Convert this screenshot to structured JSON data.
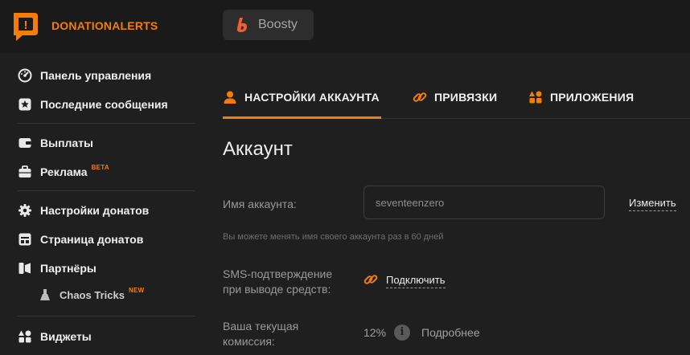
{
  "brand": {
    "name": "DONATIONALERTS",
    "logo_glyph": "!",
    "accent": "#f57d07"
  },
  "topbar": {
    "boosty_label": "Boosty",
    "boosty_color": "#f15f2c"
  },
  "sidebar": {
    "items": [
      {
        "label": "Панель управления",
        "icon": "dashboard-icon"
      },
      {
        "label": "Последние сообщения",
        "icon": "star-message-icon"
      },
      {
        "label": "Выплаты",
        "icon": "wallet-icon"
      },
      {
        "label": "Реклама",
        "icon": "briefcase-icon",
        "badge": "BETA"
      },
      {
        "label": "Настройки донатов",
        "icon": "gear-icon"
      },
      {
        "label": "Страница донатов",
        "icon": "page-icon"
      },
      {
        "label": "Партнёры",
        "icon": "partners-icon"
      },
      {
        "label": "Chaos Tricks",
        "icon": "flask-icon",
        "badge": "NEW"
      },
      {
        "label": "Виджеты",
        "icon": "widgets-icon"
      }
    ]
  },
  "tabs": [
    {
      "label": "НАСТРОЙКИ АККАУНТА",
      "icon": "user-icon",
      "active": true
    },
    {
      "label": "ПРИВЯЗКИ",
      "icon": "link-icon",
      "active": false
    },
    {
      "label": "ПРИЛОЖЕНИЯ",
      "icon": "apps-icon",
      "active": false
    }
  ],
  "account": {
    "title": "Аккаунт",
    "name_label": "Имя аккаунта:",
    "name_value": "seventeenzero",
    "change_label": "Изменить",
    "hint": "Вы можете менять имя своего аккаунта раз в 60 дней",
    "sms_label_1": "SMS-подтверждение",
    "sms_label_2": "при выводе средств:",
    "sms_action": "Подключить",
    "fee_label_1": "Ваша текущая",
    "fee_label_2": "комиссия:",
    "fee_value": "12%",
    "fee_info_glyph": "i",
    "fee_more": "Подробнее"
  }
}
